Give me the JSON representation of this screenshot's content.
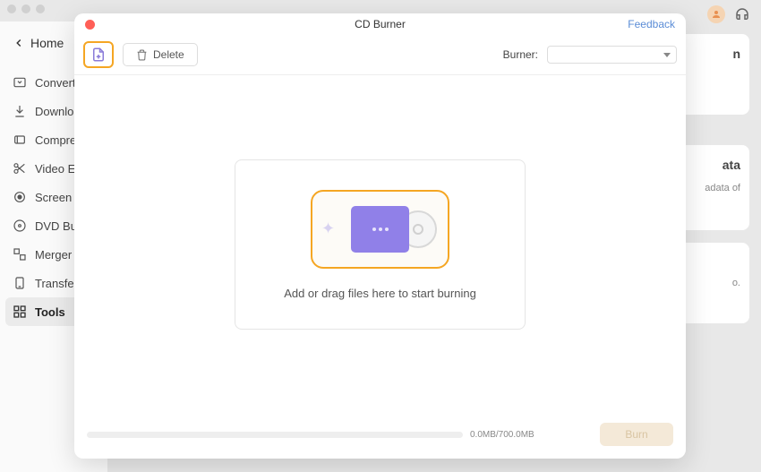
{
  "nav": {
    "home": "Home"
  },
  "sidebar": {
    "items": [
      {
        "label": "Converter"
      },
      {
        "label": "Downloader"
      },
      {
        "label": "Compressor"
      },
      {
        "label": "Video Editor"
      },
      {
        "label": "Screen Recorder"
      },
      {
        "label": "DVD Burner"
      },
      {
        "label": "Merger"
      },
      {
        "label": "Transfer"
      },
      {
        "label": "Tools"
      }
    ]
  },
  "bg": {
    "card1": "n",
    "card2_title": "ata",
    "card2_sub": "adata of",
    "card3": "o."
  },
  "modal": {
    "title": "CD Burner",
    "feedback": "Feedback",
    "delete": "Delete",
    "burner_label": "Burner:",
    "drop_text": "Add or drag files here to start burning",
    "progress": "0.0MB/700.0MB",
    "burn": "Burn"
  }
}
